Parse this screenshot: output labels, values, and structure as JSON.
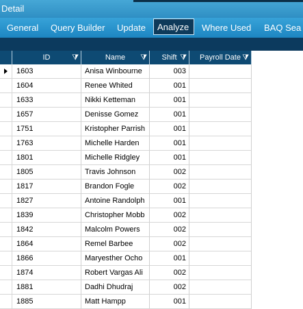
{
  "title_bar": {
    "label": "Detail"
  },
  "tabs": [
    {
      "label": "General"
    },
    {
      "label": "Query Builder"
    },
    {
      "label": "Update"
    },
    {
      "label": "Analyze"
    },
    {
      "label": "Where Used"
    },
    {
      "label": "BAQ Sea"
    }
  ],
  "active_tab": "Analyze",
  "grid": {
    "columns": [
      {
        "label": "ID",
        "filter_icon": "filter-icon"
      },
      {
        "label": "Name",
        "filter_icon": "filter-icon"
      },
      {
        "label": "Shift",
        "filter_icon": "filter-icon"
      },
      {
        "label": "Payroll Date",
        "filter_icon": "filter-icon"
      }
    ],
    "rows": [
      {
        "id": "1603",
        "name": "Anisa Winbourne",
        "shift": "003",
        "payroll_date": ""
      },
      {
        "id": "1604",
        "name": "Renee Whited",
        "shift": "001",
        "payroll_date": ""
      },
      {
        "id": "1633",
        "name": "Nikki Ketteman",
        "shift": "001",
        "payroll_date": ""
      },
      {
        "id": "1657",
        "name": "Denisse Gomez",
        "shift": "001",
        "payroll_date": ""
      },
      {
        "id": "1751",
        "name": "Kristopher Parrish",
        "shift": "001",
        "payroll_date": ""
      },
      {
        "id": "1763",
        "name": "Michelle Harden",
        "shift": "001",
        "payroll_date": ""
      },
      {
        "id": "1801",
        "name": "Michelle Ridgley",
        "shift": "001",
        "payroll_date": ""
      },
      {
        "id": "1805",
        "name": "Travis Johnson",
        "shift": "002",
        "payroll_date": ""
      },
      {
        "id": "1817",
        "name": "Brandon Fogle",
        "shift": "002",
        "payroll_date": ""
      },
      {
        "id": "1827",
        "name": "Antoine Randolph",
        "shift": "001",
        "payroll_date": ""
      },
      {
        "id": "1839",
        "name": "Christopher Mobb",
        "shift": "002",
        "payroll_date": ""
      },
      {
        "id": "1842",
        "name": "Malcolm Powers",
        "shift": "002",
        "payroll_date": ""
      },
      {
        "id": "1864",
        "name": "Remel Barbee",
        "shift": "002",
        "payroll_date": ""
      },
      {
        "id": "1866",
        "name": "Maryesther Ocho",
        "shift": "001",
        "payroll_date": ""
      },
      {
        "id": "1874",
        "name": "Robert Vargas Ali",
        "shift": "002",
        "payroll_date": ""
      },
      {
        "id": "1881",
        "name": "Dadhi Dhudraj",
        "shift": "002",
        "payroll_date": ""
      },
      {
        "id": "1885",
        "name": "Matt Hampp",
        "shift": "001",
        "payroll_date": ""
      }
    ],
    "current_row_index": 0
  },
  "colors": {
    "titlebar": "#2f8fc4",
    "tabbar": "#1d86c2",
    "header": "#0e4a73",
    "active_tab": "#0e3a5a"
  }
}
